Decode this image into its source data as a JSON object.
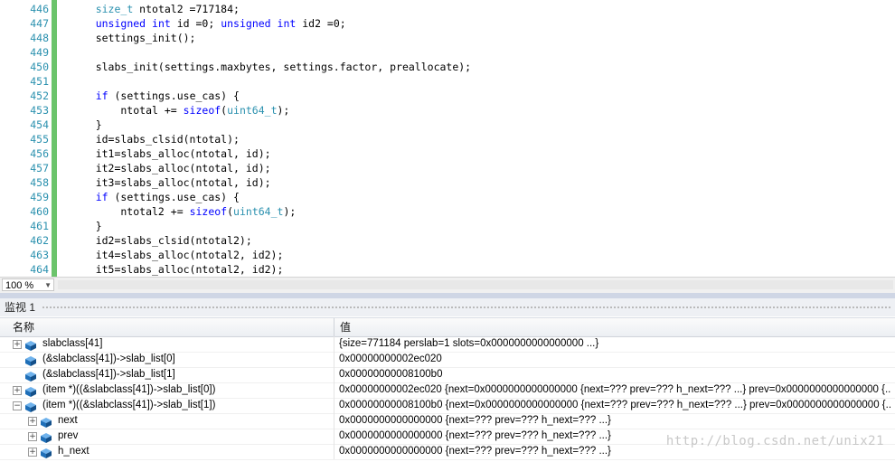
{
  "editor": {
    "lines": [
      {
        "num": "446",
        "html": "    <span class='ty'>size_t</span> ntotal2 =717184;"
      },
      {
        "num": "447",
        "html": "    <span class='kw'>unsigned</span> <span class='kw'>int</span> id =0; <span class='kw'>unsigned</span> <span class='kw'>int</span> id2 =0;"
      },
      {
        "num": "448",
        "html": "    settings_init();"
      },
      {
        "num": "449",
        "html": ""
      },
      {
        "num": "450",
        "html": "    slabs_init(settings.maxbytes, settings.factor, preallocate);"
      },
      {
        "num": "451",
        "html": ""
      },
      {
        "num": "452",
        "html": "    <span class='kw'>if</span> (settings.use_cas) {"
      },
      {
        "num": "453",
        "html": "        ntotal += <span class='kw'>sizeof</span>(<span class='ty'>uint64_t</span>);"
      },
      {
        "num": "454",
        "html": "    }"
      },
      {
        "num": "455",
        "html": "    id=slabs_clsid(ntotal);"
      },
      {
        "num": "456",
        "html": "    it1=slabs_alloc(ntotal, id);"
      },
      {
        "num": "457",
        "html": "    it2=slabs_alloc(ntotal, id);"
      },
      {
        "num": "458",
        "html": "    it3=slabs_alloc(ntotal, id);"
      },
      {
        "num": "459",
        "html": "    <span class='kw'>if</span> (settings.use_cas) {"
      },
      {
        "num": "460",
        "html": "        ntotal2 += <span class='kw'>sizeof</span>(<span class='ty'>uint64_t</span>);"
      },
      {
        "num": "461",
        "html": "    }"
      },
      {
        "num": "462",
        "html": "    id2=slabs_clsid(ntotal2);"
      },
      {
        "num": "463",
        "html": "    it4=slabs_alloc(ntotal2, id2);"
      },
      {
        "num": "464",
        "html": "    it5=slabs_alloc(ntotal2, id2);"
      }
    ],
    "zoom": "100 %"
  },
  "watch": {
    "title": "监视 1",
    "col_name": "名称",
    "col_value": "值",
    "rows": [
      {
        "indent": 0,
        "expander": "+",
        "name": "slabclass[41]",
        "value": "{size=771184 perslab=1 slots=0x0000000000000000 ...}"
      },
      {
        "indent": 0,
        "expander": "",
        "name": "(&slabclass[41])->slab_list[0]",
        "value": "0x00000000002ec020"
      },
      {
        "indent": 0,
        "expander": "",
        "name": "(&slabclass[41])->slab_list[1]",
        "value": "0x00000000008100b0"
      },
      {
        "indent": 0,
        "expander": "+",
        "name": "(item *)((&slabclass[41])->slab_list[0])",
        "value": "0x00000000002ec020 {next=0x0000000000000000 {next=??? prev=??? h_next=??? ...} prev=0x0000000000000000 {...} ...}"
      },
      {
        "indent": 0,
        "expander": "−",
        "name": "(item *)((&slabclass[41])->slab_list[1])",
        "value": "0x00000000008100b0 {next=0x0000000000000000 {next=??? prev=??? h_next=??? ...} prev=0x0000000000000000 {...} ...}"
      },
      {
        "indent": 1,
        "expander": "+",
        "name": "next",
        "value": "0x0000000000000000 {next=??? prev=??? h_next=??? ...}"
      },
      {
        "indent": 1,
        "expander": "+",
        "name": "prev",
        "value": "0x0000000000000000 {next=??? prev=??? h_next=??? ...}"
      },
      {
        "indent": 1,
        "expander": "+",
        "name": "h_next",
        "value": "0x0000000000000000 {next=??? prev=??? h_next=??? ...}"
      }
    ]
  },
  "watermark": "http://blog.csdn.net/unix21",
  "colors": {
    "line_number": "#2b91af",
    "keyword": "#0000ff",
    "type": "#2b91af",
    "change_bar": "#6bc46b",
    "cube_icon": "#1f6fb8"
  }
}
